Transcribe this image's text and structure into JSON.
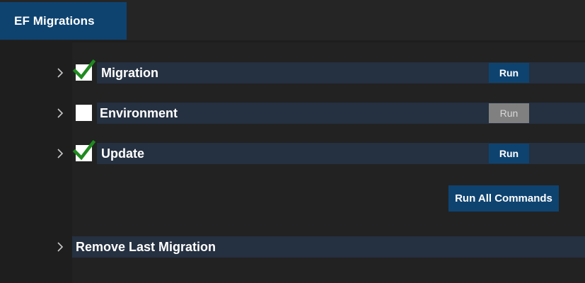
{
  "tab": {
    "title": "EF  Migrations"
  },
  "rows": [
    {
      "label": "Migration",
      "checked": true,
      "run_label": "Run",
      "run_enabled": true
    },
    {
      "label": "Environment",
      "checked": false,
      "run_label": "Run",
      "run_enabled": false
    },
    {
      "label": "Update",
      "checked": true,
      "run_label": "Run",
      "run_enabled": true
    }
  ],
  "run_all": {
    "label": "Run All Commands"
  },
  "remove_last": {
    "label": "Remove Last Migration"
  },
  "colors": {
    "accent": "#0e4370",
    "row_bar": "#253040",
    "disabled_button": "#808080",
    "check_green": "#1f8a1f",
    "background": "#1e1e1e"
  }
}
